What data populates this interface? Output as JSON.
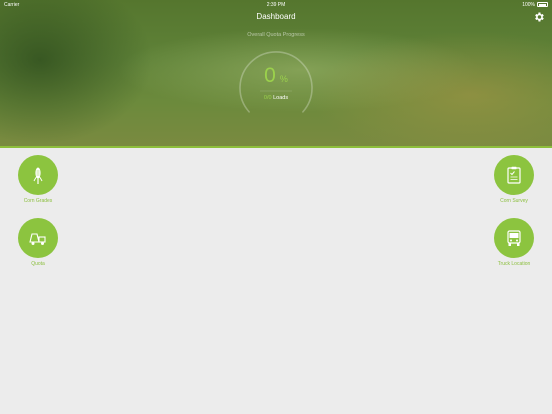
{
  "status_bar": {
    "carrier": "Carrier",
    "time": "2:39 PM",
    "battery": "100%"
  },
  "nav": {
    "title": "Dashboard"
  },
  "progress": {
    "title": "Overall Quota Progress",
    "percent": "0",
    "percent_sign": "%",
    "loads_count": "0/0",
    "loads_label": "Loads"
  },
  "tiles": {
    "corn_grades": "Corn Grades",
    "corn_survey": "Corn Survey",
    "quota": "Quota",
    "truck_location": "Truck Location"
  },
  "colors": {
    "accent": "#8cc43f",
    "accent_text": "#9bd14c",
    "header_green": "#5f8238",
    "background": "#ececec"
  }
}
